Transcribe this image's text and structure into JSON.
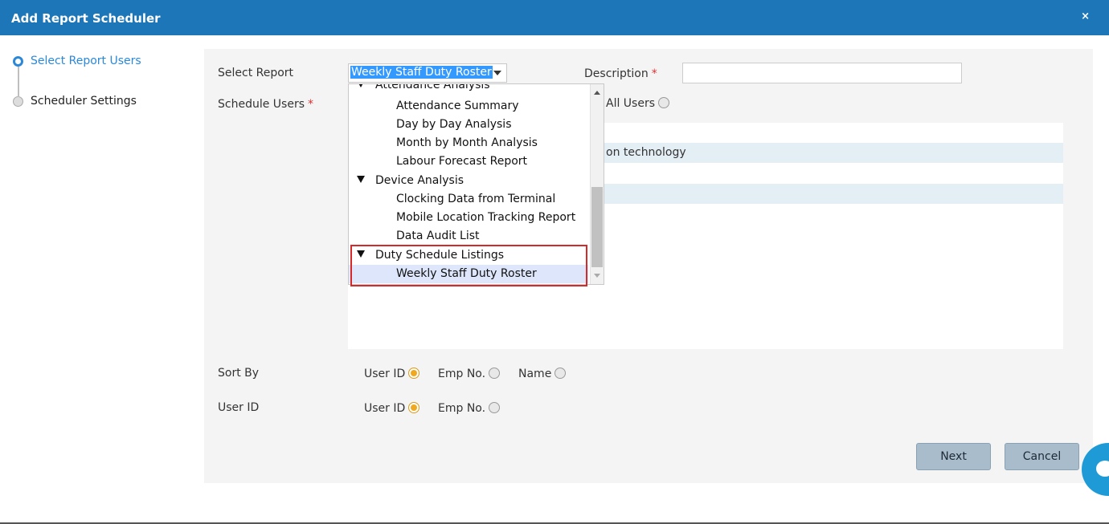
{
  "dialog": {
    "title": "Add Report Scheduler",
    "close_label": "×"
  },
  "steps": [
    {
      "label": "Select Report Users",
      "active": true
    },
    {
      "label": "Scheduler Settings",
      "active": false
    }
  ],
  "form": {
    "select_report_label": "Select Report",
    "select_report_value": "Weekly Staff Duty Roster",
    "description_label": "Description",
    "description_value": "",
    "required_mark": "*",
    "schedule_users_label": "Schedule Users",
    "all_users_label": "All Users",
    "list_rows": [
      "",
      "on technology",
      "",
      ""
    ],
    "sort_by_label": "Sort By",
    "sort_by_options": [
      "User ID",
      "Emp No.",
      "Name"
    ],
    "sort_by_selected": "User ID",
    "user_id_label": "User ID",
    "user_id_options": [
      "User ID",
      "Emp No."
    ],
    "user_id_selected": "User ID"
  },
  "dropdown": {
    "items": [
      {
        "type": "group",
        "label": "Attendance Analysis"
      },
      {
        "type": "child",
        "label": "Attendance Summary"
      },
      {
        "type": "child",
        "label": "Day by Day Analysis"
      },
      {
        "type": "child",
        "label": "Month by Month Analysis"
      },
      {
        "type": "child",
        "label": "Labour Forecast Report"
      },
      {
        "type": "group",
        "label": "Device Analysis"
      },
      {
        "type": "child",
        "label": "Clocking Data from Terminal"
      },
      {
        "type": "child",
        "label": "Mobile Location Tracking Report"
      },
      {
        "type": "child",
        "label": "Data Audit List"
      },
      {
        "type": "group",
        "label": "Duty Schedule Listings"
      },
      {
        "type": "child",
        "label": "Weekly Staff Duty Roster",
        "selected": true
      }
    ]
  },
  "buttons": {
    "next": "Next",
    "cancel": "Cancel"
  },
  "colors": {
    "titlebar": "#1c76b7",
    "active_step": "#2b88d8",
    "selected_radio": "#f0a820",
    "highlight_border": "#d62a2a",
    "button_bg": "#a9bccb",
    "chat_widget": "#1e9ad6"
  },
  "icons": {
    "close": "close-icon",
    "chat": "chat-icon"
  }
}
